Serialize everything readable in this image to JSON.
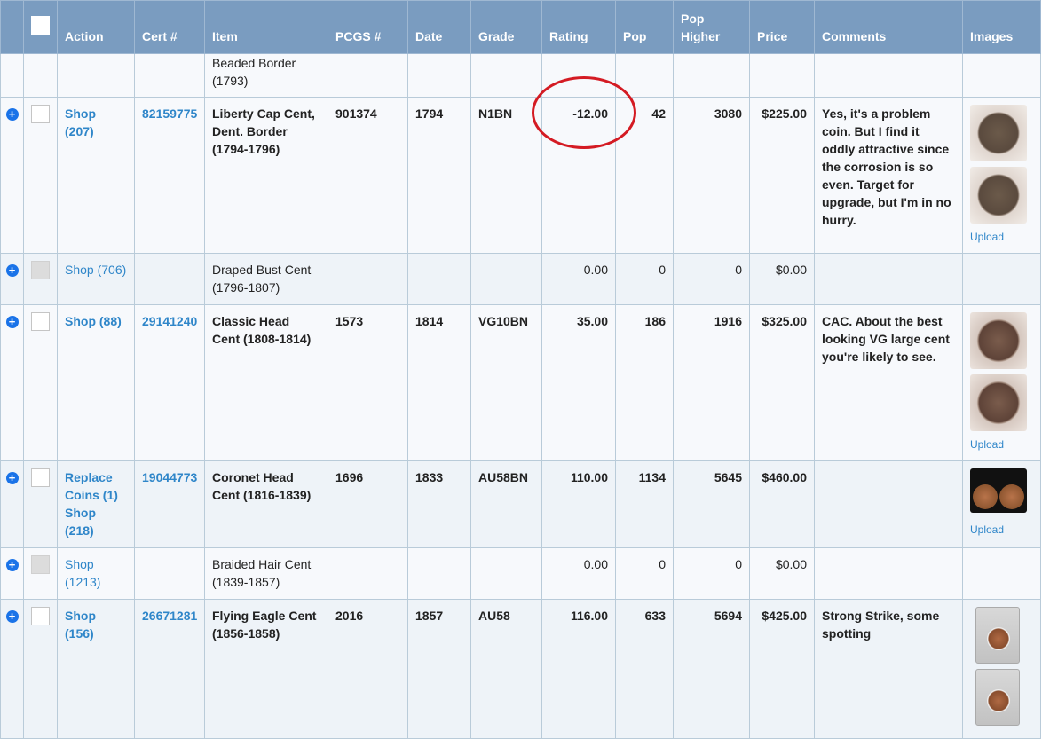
{
  "header": {
    "action": "Action",
    "cert": "Cert #",
    "item": "Item",
    "pcgs": "PCGS #",
    "date": "Date",
    "grade": "Grade",
    "rating": "Rating",
    "pop": "Pop",
    "pop_higher_1": "Pop",
    "pop_higher_2": "Higher",
    "price": "Price",
    "comments": "Comments",
    "images": "Images"
  },
  "partial_row": {
    "item_line1": "Beaded Border",
    "item_line2": "(1793)"
  },
  "rows": [
    {
      "action_line1": "Shop",
      "action_line2": "(207)",
      "cert": "82159775",
      "item_line1": "Liberty Cap Cent,",
      "item_line2": "Dent. Border",
      "item_line3": "(1794-1796)",
      "pcgs": "901374",
      "date": "1794",
      "grade": "N1BN",
      "rating": "-12.00",
      "pop": "42",
      "pop_higher": "3080",
      "price": "$225.00",
      "comments": "Yes, it's a problem coin. But I find it oddly attractive since the corrosion is so even. Target for upgrade, but I'm in no hurry.",
      "upload": "Upload"
    },
    {
      "action": "Shop (706)",
      "item_line1": "Draped Bust Cent",
      "item_line2": "(1796-1807)",
      "rating": "0.00",
      "pop": "0",
      "pop_higher": "0",
      "price": "$0.00"
    },
    {
      "action": "Shop (88)",
      "cert": "29141240",
      "item_line1": "Classic Head",
      "item_line2": "Cent (1808-1814)",
      "pcgs": "1573",
      "date": "1814",
      "grade": "VG10BN",
      "rating": "35.00",
      "pop": "186",
      "pop_higher": "1916",
      "price": "$325.00",
      "comments": "CAC. About the best looking VG large cent you're likely to see.",
      "upload": "Upload"
    },
    {
      "action_line1": "Replace",
      "action_line2": "Coins (1)",
      "action_line3": "Shop",
      "action_line4": "(218)",
      "cert": "19044773",
      "item_line1": "Coronet Head",
      "item_line2": "Cent (1816-1839)",
      "pcgs": "1696",
      "date": "1833",
      "grade": "AU58BN",
      "rating": "110.00",
      "pop": "1134",
      "pop_higher": "5645",
      "price": "$460.00",
      "upload": "Upload"
    },
    {
      "action_line1": "Shop",
      "action_line2": "(1213)",
      "item_line1": "Braided Hair Cent",
      "item_line2": "(1839-1857)",
      "rating": "0.00",
      "pop": "0",
      "pop_higher": "0",
      "price": "$0.00"
    },
    {
      "action_line1": "Shop",
      "action_line2": "(156)",
      "cert": "26671281",
      "item_line1": "Flying Eagle Cent",
      "item_line2": "(1856-1858)",
      "pcgs": "2016",
      "date": "1857",
      "grade": "AU58",
      "rating": "116.00",
      "pop": "633",
      "pop_higher": "5694",
      "price": "$425.00",
      "comments": "Strong Strike, some spotting"
    }
  ],
  "colors": {
    "header_bg": "#7a9cc0",
    "link": "#2f86c9",
    "annotation_circle": "#d41b23",
    "plus_icon": "#1a73e8"
  }
}
